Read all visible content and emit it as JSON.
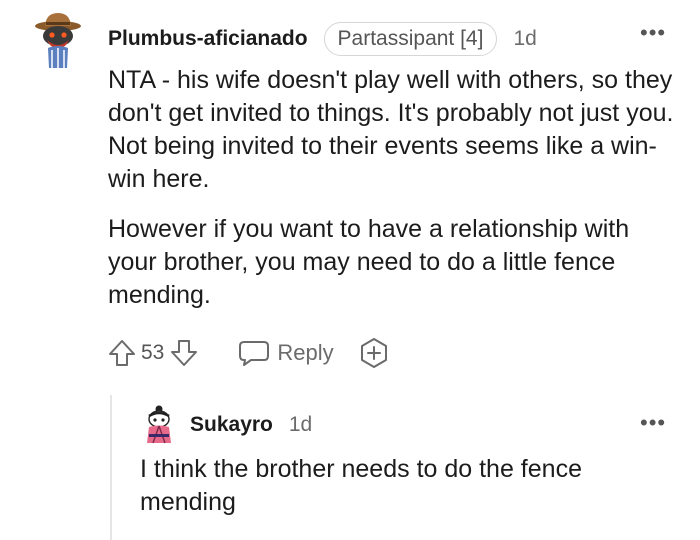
{
  "comments": [
    {
      "username": "Plumbus-aficianado",
      "flair": "Partassipant [4]",
      "time": "1d",
      "paragraphs": [
        "NTA - his wife doesn't play well with others, so they don't get invited to things. It's probably not just you. Not being invited to their events seems like a win-win here.",
        "However if you want to have a relationship with your brother, you may need to do a little fence mending."
      ],
      "score": "53",
      "reply_label": "Reply",
      "more_label": "•••"
    },
    {
      "username": "Sukayro",
      "time": "1d",
      "paragraphs": [
        "I think the brother needs to do the fence mending"
      ],
      "more_label": "•••"
    }
  ],
  "icons": {
    "upvote": "upvote-arrow",
    "downvote": "downvote-arrow",
    "reply": "speech-bubble",
    "award": "award-plus",
    "more": "ellipsis"
  },
  "colors": {
    "text": "#1c1c1c",
    "meta": "#6b6b6b",
    "flair_border": "#d6d6d6",
    "thread_line": "#e5e5e5"
  }
}
